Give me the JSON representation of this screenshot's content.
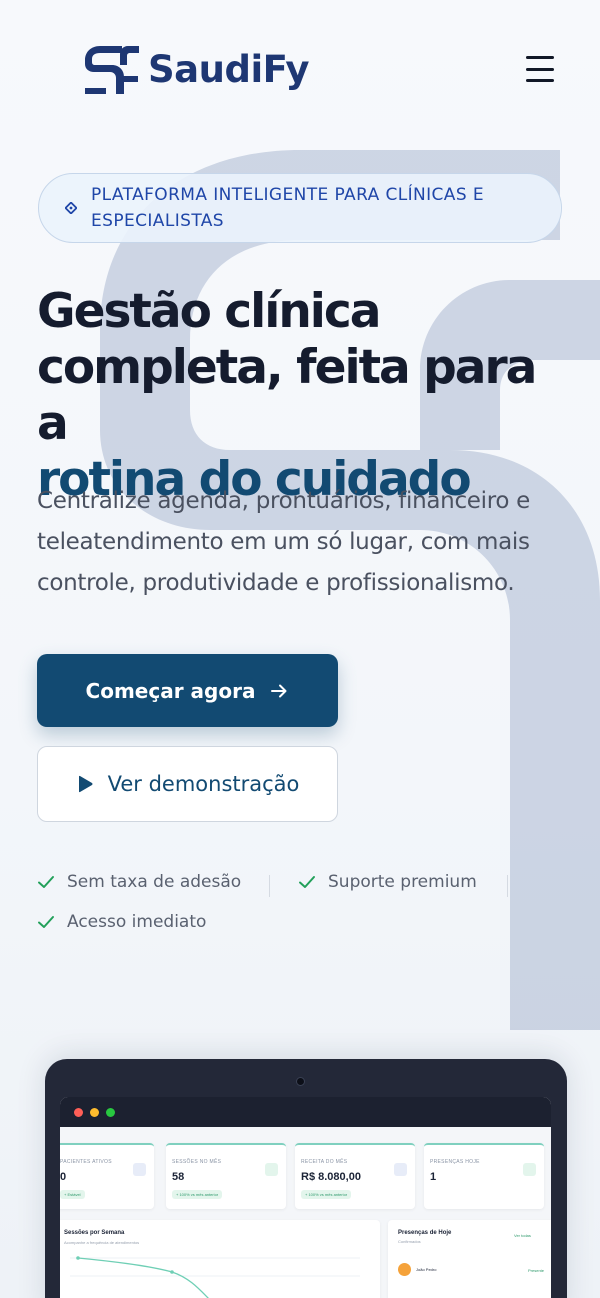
{
  "brand": {
    "name": "SaudiFy",
    "primary_color": "#124a72",
    "logo_color": "#1e3773"
  },
  "nav": {
    "menu_icon": "hamburger-menu-icon"
  },
  "hero": {
    "badge": "PLATAFORMA INTELIGENTE PARA CLÍNICAS E ESPECIALISTAS",
    "headline_line1": "Gestão clínica",
    "headline_line2": "completa, feita para a",
    "headline_accent": "rotina do cuidado",
    "subtitle": "Centralize agenda, prontuários, financeiro e teleatendimento em um só lugar, com mais controle, produtividade e profissionalismo.",
    "cta_primary": "Começar agora",
    "cta_secondary": "Ver demonstração"
  },
  "features": [
    {
      "label": "Sem taxa de adesão",
      "icon": "check-icon"
    },
    {
      "label": "Suporte premium",
      "icon": "check-icon"
    },
    {
      "label": "Acesso imediato",
      "icon": "check-icon"
    }
  ],
  "dashboard_preview": {
    "stats": [
      {
        "label": "PACIENTES ATIVOS",
        "value": "0",
        "chip": "+ Estável"
      },
      {
        "label": "SESSÕES NO MÊS",
        "value": "58",
        "chip": "+ 100% vs mês anterior"
      },
      {
        "label": "RECEITA DO MÊS",
        "value": "R$ 8.080,00",
        "chip": "+ 100% vs mês anterior"
      },
      {
        "label": "PRESENÇAS HOJE",
        "value": "1",
        "chip": ""
      }
    ],
    "chart_panel": {
      "title": "Sessões por Semana",
      "subtitle": "Acompanhe a frequência de atendimentos"
    },
    "today_panel": {
      "title": "Presenças de Hoje",
      "subtitle": "Confirmados",
      "link": "Ver todas",
      "patient": "João Pedro",
      "status": "Presente"
    }
  }
}
